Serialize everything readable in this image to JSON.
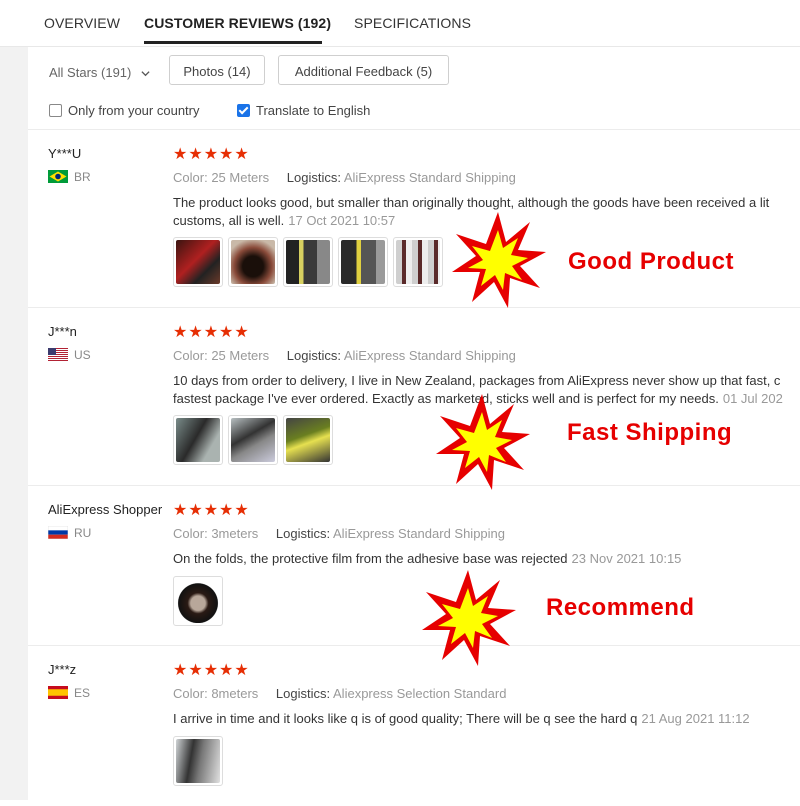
{
  "tabs": [
    {
      "label": "OVERVIEW"
    },
    {
      "label": "CUSTOMER REVIEWS (192)"
    },
    {
      "label": "SPECIFICATIONS"
    }
  ],
  "filters": {
    "stars_select": "All Stars (191)",
    "photos_button": "Photos (14)",
    "additional_button": "Additional Feedback (5)",
    "only_country": "Only from your country",
    "only_country_checked": false,
    "translate": "Translate to English",
    "translate_checked": true
  },
  "reviews": [
    {
      "name": "Y***U",
      "country": "BR",
      "stars": "★★★★★",
      "color_label": "Color:",
      "color_value": "25 Meters",
      "logistics_label": "Logistics:",
      "logistics_value": "AliExpress Standard Shipping",
      "text_line1": "The product looks good, but smaller than originally thought, although the goods have been received a lit",
      "text_line2": "customs, all is well.",
      "date": "17 Oct 2021 10:57",
      "photos": 5
    },
    {
      "name": "J***n",
      "country": "US",
      "stars": "★★★★★",
      "color_label": "Color:",
      "color_value": "25 Meters",
      "logistics_label": "Logistics:",
      "logistics_value": "AliExpress Standard Shipping",
      "text_line1": "10 days from order to delivery, I live in New Zealand, packages from AliExpress never show up that fast, c",
      "text_line2": "fastest package I've ever ordered. Exactly as marketed, sticks well and is perfect for my needs.",
      "date": "01 Jul 202",
      "photos": 3
    },
    {
      "name": "AliExpress Shopper",
      "country": "RU",
      "stars": "★★★★★",
      "color_label": "Color:",
      "color_value": "3meters",
      "logistics_label": "Logistics:",
      "logistics_value": "AliExpress Standard Shipping",
      "text_line1": "On the folds, the protective film from the adhesive base was rejected",
      "date": "23 Nov 2021 10:15",
      "photos": 1
    },
    {
      "name": "J***z",
      "country": "ES",
      "stars": "★★★★★",
      "color_label": "Color:",
      "color_value": "8meters",
      "logistics_label": "Logistics:",
      "logistics_value": "Aliexpress Selection Standard",
      "text_line1": "I arrive in time and it looks like q is of good quality; There will be q see the hard q",
      "date": "21 Aug 2021 11:12",
      "photos": 1
    }
  ],
  "overlays": [
    {
      "label": "Good Product"
    },
    {
      "label": "Fast Shipping"
    },
    {
      "label": "Recommend"
    }
  ],
  "colors": {
    "star": "#e62e04",
    "overlay_text": "#e60000",
    "burst_outer": "#e60000",
    "burst_inner": "#ffff00",
    "checkbox_checked": "#1a73e8"
  },
  "icons": {
    "collapse": "chevron-down-icon",
    "select_caret": "chevron-down-icon",
    "burst": "starburst-icon"
  }
}
